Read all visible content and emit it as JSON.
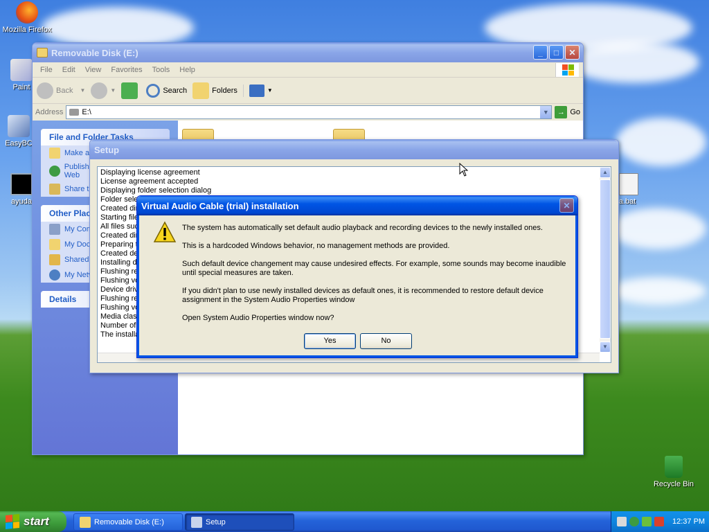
{
  "desktop": {
    "icons": [
      {
        "label": "Mozilla Firefox",
        "icon": "firefox-icon"
      },
      {
        "label": "Paint",
        "icon": "paint-icon"
      },
      {
        "label": "EasyBC",
        "icon": "easybc-icon"
      },
      {
        "label": "ayuda",
        "icon": "cmd-icon"
      },
      {
        "label": "a.bat",
        "icon": "batch-file-icon"
      },
      {
        "label": "Recycle Bin",
        "icon": "recycle-bin-icon"
      }
    ]
  },
  "explorer": {
    "title": "Removable Disk (E:)",
    "menu": [
      "File",
      "Edit",
      "View",
      "Favorites",
      "Tools",
      "Help"
    ],
    "toolbar": {
      "back": "Back",
      "search": "Search",
      "folders": "Folders"
    },
    "address": {
      "label": "Address",
      "value": "E:\\",
      "go": "Go"
    },
    "taskpane": {
      "file_folder_tasks": {
        "title": "File and Folder Tasks",
        "items": [
          "Make a new folder",
          "Publish this folder to the Web",
          "Share this folder"
        ]
      },
      "other_places": {
        "title": "Other Places",
        "items": [
          "My Computer",
          "My Documents",
          "Shared Documents",
          "My Network Places"
        ]
      },
      "details": {
        "title": "Details"
      }
    }
  },
  "setup": {
    "title": "Setup",
    "log": [
      "Displaying license agreement",
      "License agreement accepted",
      "Displaying folder selection dialog",
      "Folder selected",
      "Created directory",
      "Starting file copy",
      "All files successfully copied",
      "Created directory",
      "Preparing to install",
      "Created device",
      "Installing device",
      "Flushing registry",
      "Flushing volumes",
      "Device driver installed",
      "Flushing registry",
      "Flushing volumes",
      "Media class",
      "Number of",
      "The installation"
    ]
  },
  "dialog": {
    "title": "Virtual Audio Cable (trial) installation",
    "messages": [
      "The system has automatically set default audio playback and recording devices to the newly installed ones.",
      "This is a hardcoded Windows behavior, no management methods are provided.",
      "Such default device changement may cause undesired effects. For example, some sounds may become inaudible until special measures are taken.",
      "If you didn't plan to use newly installed devices as default ones, it is recommended to restore default device assignment in the System Audio Properties window",
      "Open System Audio Properties window now?"
    ],
    "yes": "Yes",
    "no": "No"
  },
  "taskbar": {
    "start": "start",
    "tasks": [
      {
        "label": "Removable Disk (E:)",
        "pressed": false
      },
      {
        "label": "Setup",
        "pressed": true
      }
    ],
    "clock": "12:37 PM"
  }
}
